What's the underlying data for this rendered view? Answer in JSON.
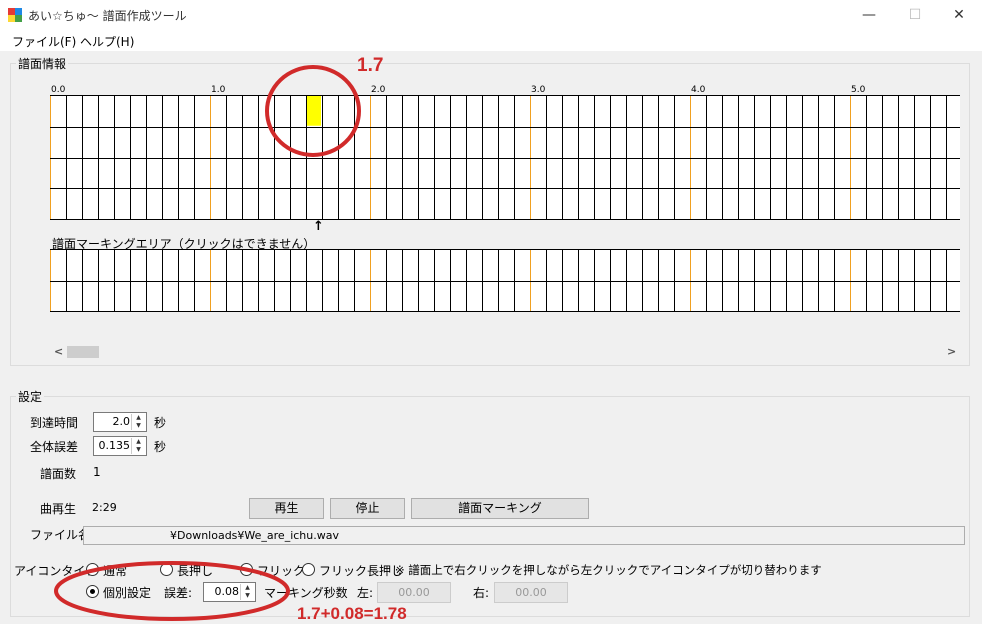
{
  "window": {
    "title": "あい☆ちゅ〜 譜面作成ツール",
    "minimize": "—",
    "maximize": "☐",
    "close": "✕"
  },
  "menu": [
    "ファイル(F)",
    "ヘルプ(H)"
  ],
  "chart_group": {
    "label": "譜面情報",
    "ticks": [
      "0.0",
      "1.0",
      "2.0",
      "3.0",
      "4.0",
      "5.0"
    ],
    "marker_arrow": "↑",
    "marking_label": "譜面マーキングエリア（クリックはできません）",
    "scroll_left": "<",
    "scroll_right": ">",
    "highlight_color": "#ffff00",
    "beat_line_color": "#f0a020"
  },
  "settings": {
    "label": "設定",
    "arrival_time_label": "到達時間",
    "arrival_time_value": "2.0",
    "arrival_time_unit": "秒",
    "total_error_label": "全体誤差",
    "total_error_value": "0.135",
    "total_error_unit": "秒",
    "chart_count_label": "譜面数",
    "chart_count_value": "1",
    "song_play_label": "曲再生",
    "song_time": "2:29",
    "play_button": "再生",
    "stop_button": "停止",
    "marking_button": "譜面マーキング",
    "file_label": "ファイル名",
    "file_path": "¥Downloads¥We_are_ichu.wav",
    "icon_type_label": "アイコンタイプ",
    "icon_types": [
      "通常",
      "長押し",
      "フリック",
      "フリック長押し"
    ],
    "icon_type_note": "※ 譜面上で右クリックを押しながら左クリックでアイコンタイプが切り替わります",
    "individual_setting_label": "個別設定",
    "error_label": "誤差:",
    "error_value": "0.08",
    "marking_seconds_label": "マーキング秒数",
    "left_label": "左:",
    "left_value": "00.00",
    "right_label": "右:",
    "right_value": "00.00"
  },
  "annotations": {
    "circle_label": "1.7",
    "formula": "1.7+0.08=1.78",
    "color": "#d12a2a"
  }
}
